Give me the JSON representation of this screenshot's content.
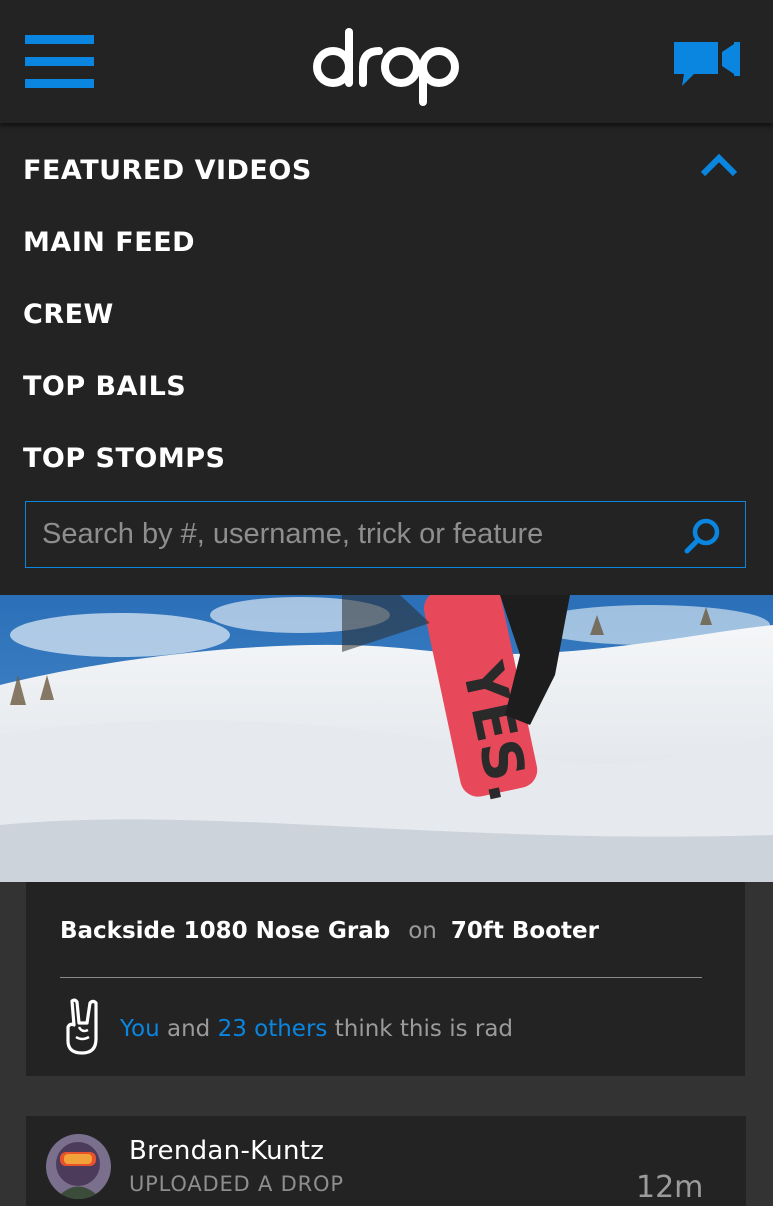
{
  "app": {
    "logo_text": "drop"
  },
  "colors": {
    "accent": "#0a85e0",
    "background": "#232323",
    "page": "#333333"
  },
  "header": {
    "menu_icon": "hamburger-icon",
    "record_icon": "video-camera-icon"
  },
  "menu": {
    "items": [
      {
        "label": "FEATURED VIDEOS"
      },
      {
        "label": "MAIN FEED"
      },
      {
        "label": "CREW"
      },
      {
        "label": "TOP BAILS"
      },
      {
        "label": "TOP STOMPS"
      }
    ],
    "collapse_icon": "chevron-up-icon"
  },
  "search": {
    "placeholder": "Search by #, username, trick or feature",
    "value": "",
    "icon": "search-icon"
  },
  "video_card": {
    "play_icon": "play-icon",
    "trick": "Backside 1080 Nose Grab",
    "on_word": "on",
    "feature": "70ft Booter",
    "rad_you": "You",
    "rad_and": "and",
    "rad_others": "23 others",
    "rad_suffix": "think this is rad",
    "rad_icon": "rock-hand-icon"
  },
  "post": {
    "username": "Brendan-Kuntz",
    "action": "UPLOADED A DROP",
    "time": "12m"
  }
}
